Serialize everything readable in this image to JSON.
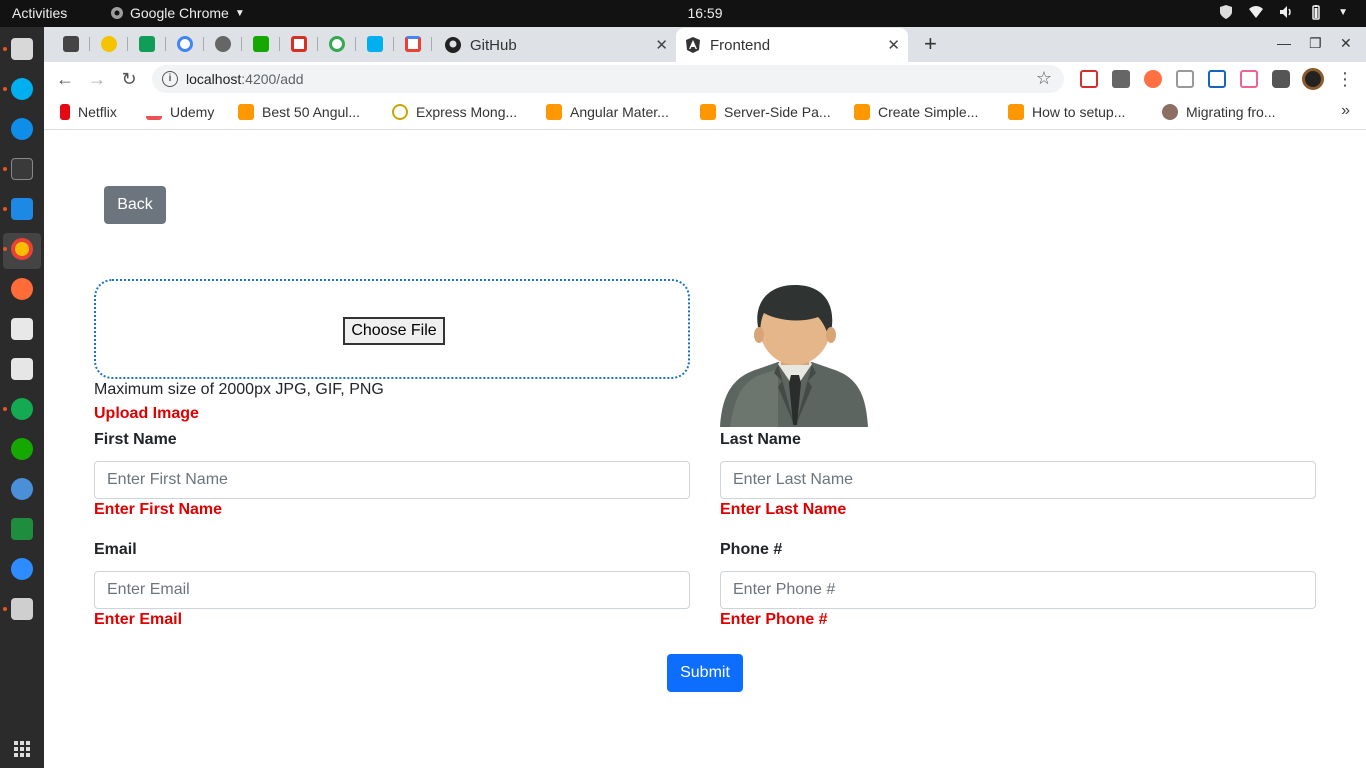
{
  "system_bar": {
    "activities": "Activities",
    "app_name": "Google Chrome",
    "clock": "16:59"
  },
  "browser": {
    "tabs": [
      {
        "label": "GitHub"
      },
      {
        "label": "Frontend"
      }
    ],
    "url_host": "localhost",
    "url_path": ":4200/add",
    "bookmarks": [
      {
        "label": "Netflix"
      },
      {
        "label": "Udemy"
      },
      {
        "label": "Best 50 Angul..."
      },
      {
        "label": "Express Mong..."
      },
      {
        "label": "Angular Mater..."
      },
      {
        "label": "Server-Side Pa..."
      },
      {
        "label": "Create Simple..."
      },
      {
        "label": "How to setup..."
      },
      {
        "label": "Migrating fro..."
      }
    ]
  },
  "form": {
    "back_label": "Back",
    "choose_file_label": "Choose File",
    "max_size_text": "Maximum size of 2000px JPG, GIF, PNG",
    "upload_error": "Upload Image",
    "first_name": {
      "label": "First Name",
      "placeholder": "Enter First Name",
      "error": "Enter First Name"
    },
    "last_name": {
      "label": "Last Name",
      "placeholder": "Enter Last Name",
      "error": "Enter Last Name"
    },
    "email": {
      "label": "Email",
      "placeholder": "Enter Email",
      "error": "Enter Email"
    },
    "phone": {
      "label": "Phone #",
      "placeholder": "Enter Phone #",
      "error": "Enter Phone #"
    },
    "submit_label": "Submit"
  },
  "colors": {
    "primary": "#0d6efd",
    "secondary": "#6c757d",
    "error": "#e00000",
    "dropzone_border": "#1a73c8"
  }
}
